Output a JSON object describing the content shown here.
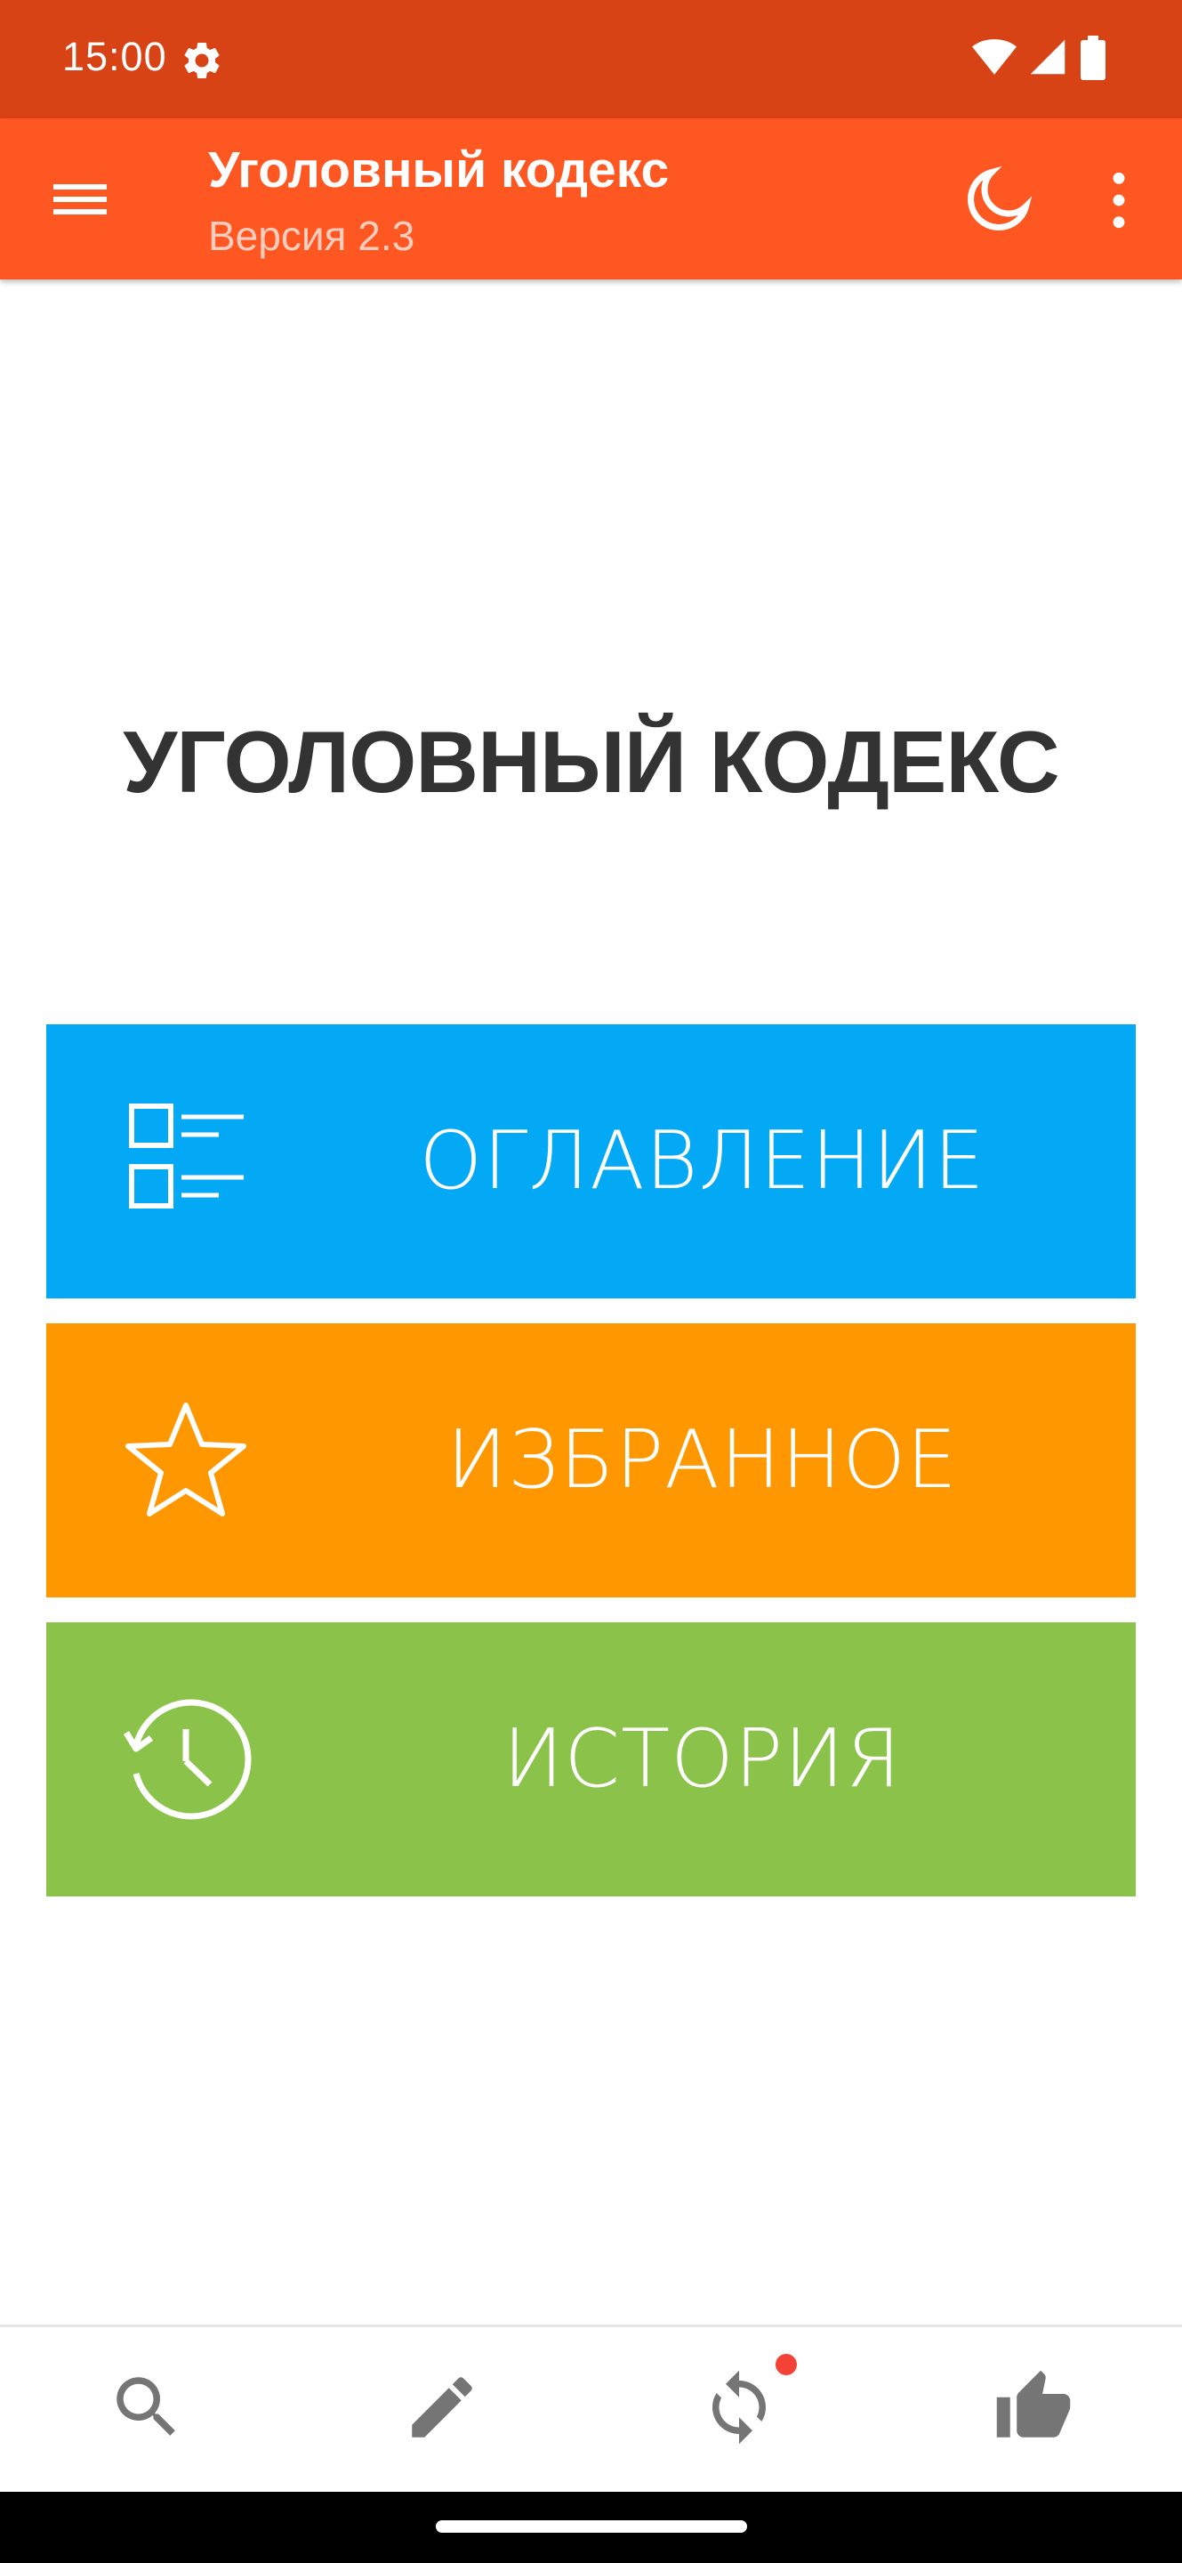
{
  "status_bar": {
    "time": "15:00",
    "icons": [
      "settings-gear-icon",
      "wifi-icon",
      "cell-signal-icon",
      "battery-icon"
    ]
  },
  "app_bar": {
    "title": "Уголовный кодекс",
    "subtitle": "Версия 2.3",
    "icons": [
      "menu-icon",
      "moon-icon",
      "more-vert-icon"
    ],
    "color": "#ff5722"
  },
  "main": {
    "heading": "УГОЛОВНЫЙ КОДЕКС",
    "tiles": [
      {
        "label": "ОГЛАВЛЕНИЕ",
        "icon": "checklist-icon",
        "color": "#03a9f4"
      },
      {
        "label": "ИЗБРАННОЕ",
        "icon": "star-icon",
        "color": "#ff9800"
      },
      {
        "label": "ИСТОРИЯ",
        "icon": "history-icon",
        "color": "#8bc34a"
      }
    ]
  },
  "bottom_nav": {
    "items": [
      {
        "icon": "search-icon"
      },
      {
        "icon": "pencil-icon"
      },
      {
        "icon": "sync-icon",
        "badge": true,
        "badge_color": "#f44336"
      },
      {
        "icon": "thumbs-up-icon"
      }
    ]
  }
}
